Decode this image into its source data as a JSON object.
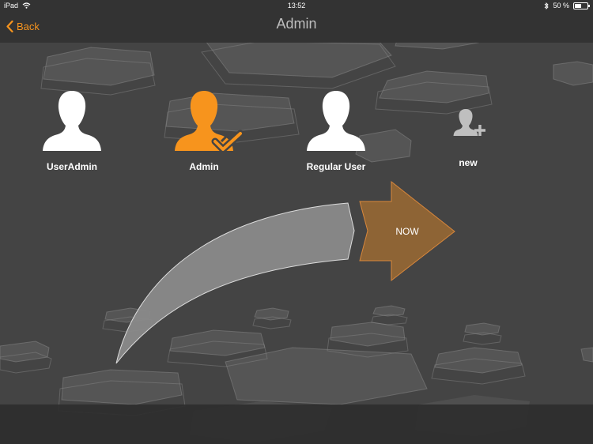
{
  "status_bar": {
    "device": "iPad",
    "time": "13:52",
    "battery": "50 %",
    "battery_level": 0.5
  },
  "nav": {
    "back_label": "Back",
    "title": "Admin"
  },
  "users": [
    {
      "name": "UserAdmin",
      "color": "#ffffff"
    },
    {
      "name": "Admin",
      "color": "#f7941d",
      "selected": true
    },
    {
      "name": "Regular User",
      "color": "#ffffff"
    },
    {
      "name": "new",
      "color": "#bfbfbf",
      "icon": "add-user-icon"
    }
  ],
  "flow": {
    "now_label": "NOW"
  },
  "colors": {
    "accent": "#f7941d",
    "now_arrow": "#8e6435",
    "curve_arrow": "#8a8a8a"
  }
}
